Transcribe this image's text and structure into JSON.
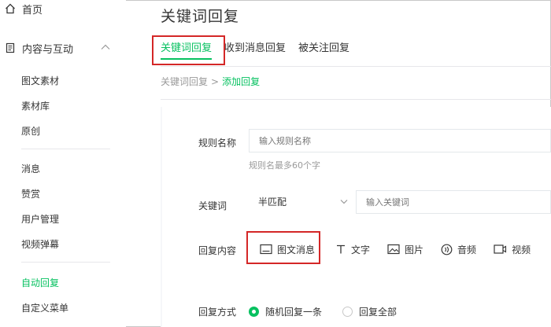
{
  "sidebar": {
    "home_label": "首页",
    "section_label": "内容与互动",
    "group1": [
      "图文素材",
      "素材库",
      "原创"
    ],
    "group2": [
      "消息",
      "赞赏",
      "用户管理",
      "视频弹幕"
    ],
    "group3": [
      "自动回复",
      "自定义菜单"
    ]
  },
  "page": {
    "title": "关键词回复",
    "tabs": [
      "关键词回复",
      "收到消息回复",
      "被关注回复"
    ],
    "breadcrumb": {
      "parent": "关键词回复",
      "separator": ">",
      "current": "添加回复"
    }
  },
  "form": {
    "rule_name": {
      "label": "规则名称",
      "placeholder": "输入规则名称",
      "hint": "规则名最多60个字"
    },
    "keyword": {
      "label": "关键词",
      "match_mode": "半匹配",
      "placeholder": "输入关键词"
    },
    "reply_content": {
      "label": "回复内容",
      "types": [
        {
          "icon": "image-text-icon",
          "label": "图文消息"
        },
        {
          "icon": "text-icon",
          "label": "文字"
        },
        {
          "icon": "image-icon",
          "label": "图片"
        },
        {
          "icon": "audio-icon",
          "label": "音频"
        },
        {
          "icon": "video-icon",
          "label": "视频"
        }
      ]
    },
    "reply_mode": {
      "label": "回复方式",
      "options": [
        "随机回复一条",
        "回复全部"
      ],
      "selected": "随机回复一条"
    }
  },
  "colors": {
    "accent": "#07c160",
    "highlight": "#d42727",
    "text": "#353535",
    "muted": "#9a9a9a"
  }
}
